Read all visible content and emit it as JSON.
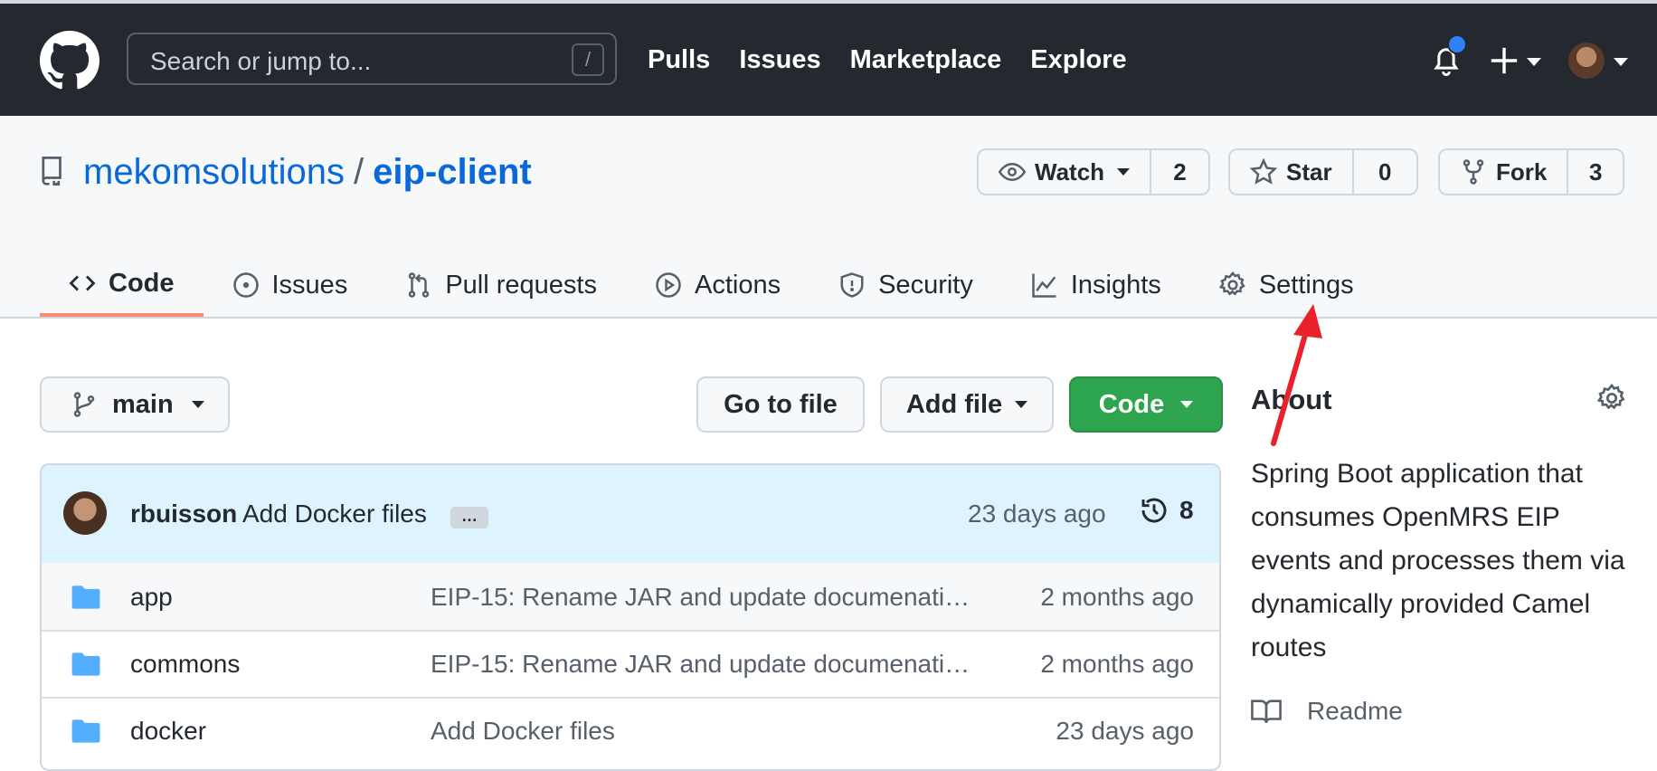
{
  "header": {
    "search_placeholder": "Search or jump to...",
    "search_key": "/",
    "nav": [
      "Pulls",
      "Issues",
      "Marketplace",
      "Explore"
    ]
  },
  "repo": {
    "owner": "mekomsolutions",
    "separator": "/",
    "name": "eip-client",
    "watch": {
      "label": "Watch",
      "count": "2"
    },
    "star": {
      "label": "Star",
      "count": "0"
    },
    "fork": {
      "label": "Fork",
      "count": "3"
    }
  },
  "tabs": [
    {
      "label": "Code",
      "icon": "code-icon"
    },
    {
      "label": "Issues",
      "icon": "issue-icon"
    },
    {
      "label": "Pull requests",
      "icon": "pull-request-icon"
    },
    {
      "label": "Actions",
      "icon": "play-icon"
    },
    {
      "label": "Security",
      "icon": "shield-icon"
    },
    {
      "label": "Insights",
      "icon": "graph-icon"
    },
    {
      "label": "Settings",
      "icon": "gear-icon"
    }
  ],
  "toolbar": {
    "branch": "main",
    "go_to_file": "Go to file",
    "add_file": "Add file",
    "code": "Code"
  },
  "commit": {
    "author": "rbuisson",
    "message": "Add Docker files",
    "ellipsis": "…",
    "time": "23 days ago",
    "count": "8"
  },
  "files": [
    {
      "name": "app",
      "message": "EIP-15: Rename JAR and update documenati…",
      "time": "2 months ago"
    },
    {
      "name": "commons",
      "message": "EIP-15: Rename JAR and update documenati…",
      "time": "2 months ago"
    },
    {
      "name": "docker",
      "message": "Add Docker files",
      "time": "23 days ago"
    }
  ],
  "about": {
    "title": "About",
    "description": "Spring Boot application that consumes OpenMRS EIP events and processes them via dynamically provided Camel routes",
    "readme": "Readme"
  },
  "colors": {
    "header_bg": "#24292f",
    "link": "#0969da",
    "green": "#2da44e",
    "active_tab_underline": "#fd8c73",
    "annotation_arrow": "#e8212b"
  }
}
